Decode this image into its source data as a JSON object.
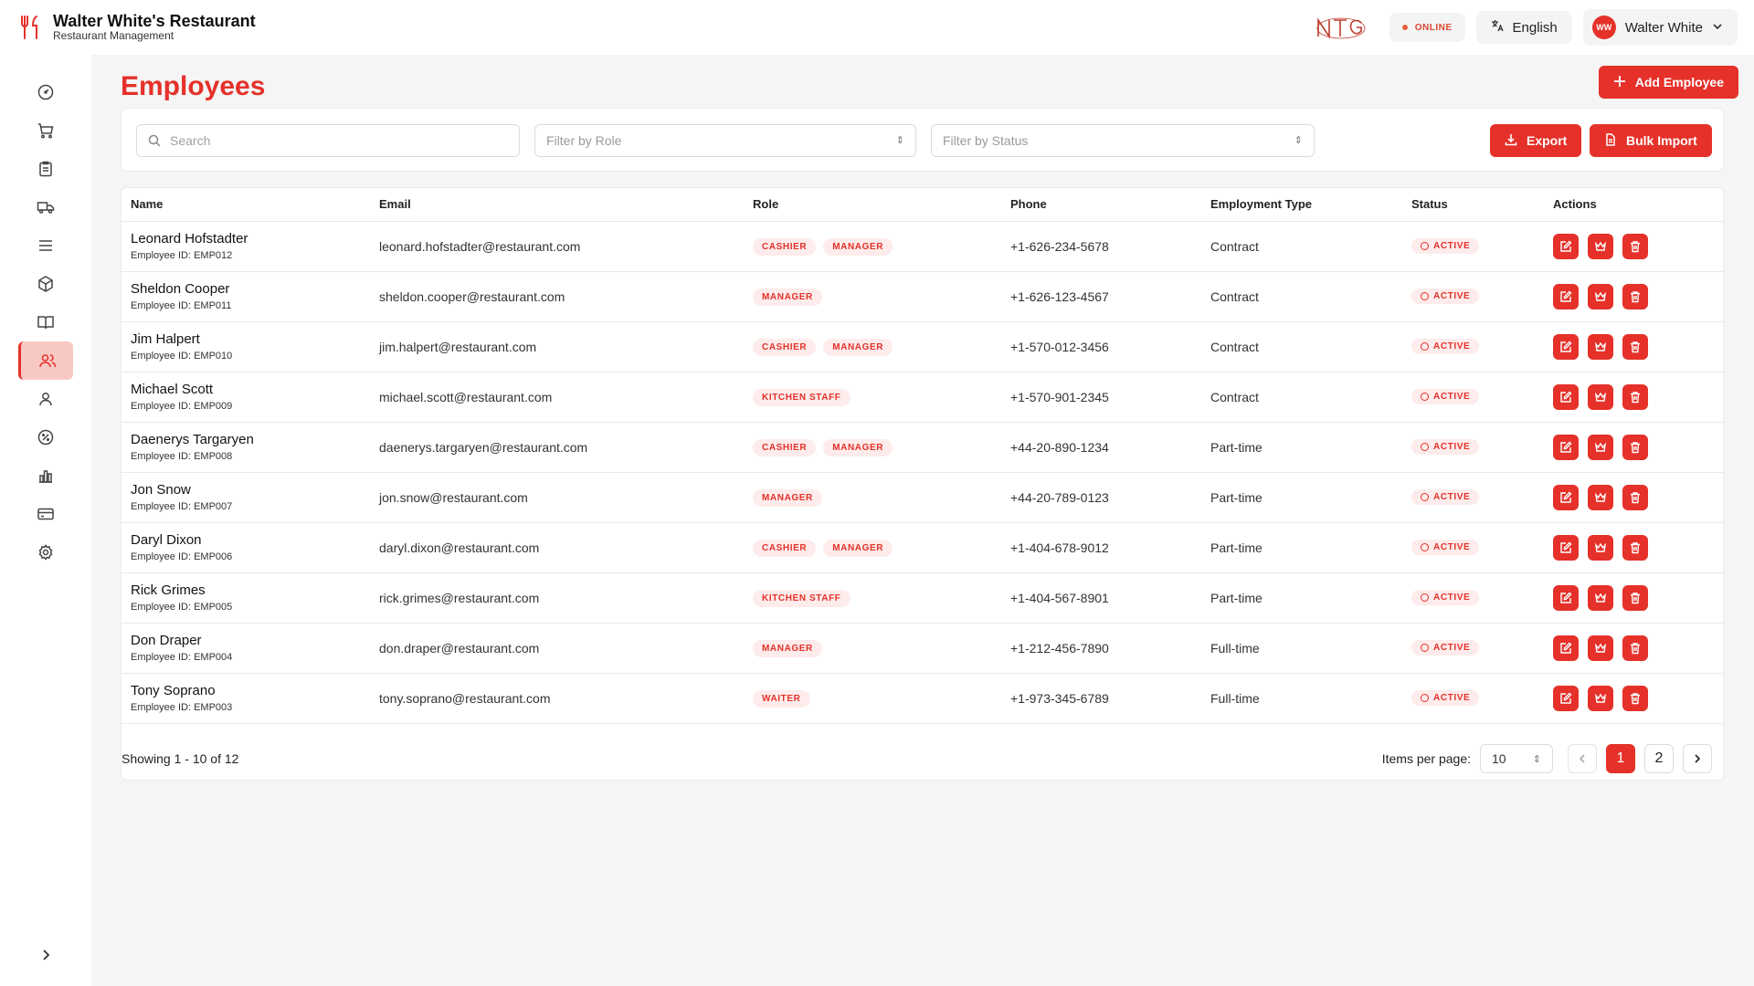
{
  "app": {
    "title": "Walter White's Restaurant",
    "subtitle": "Restaurant Management"
  },
  "header": {
    "status": "ONLINE",
    "language": "English",
    "user": {
      "initials": "WW",
      "name": "Walter White"
    }
  },
  "colors": {
    "accent": "#e5312a",
    "accent_soft": "#fdeceb",
    "active_nav": "#f8c9c4"
  },
  "sidebar": {
    "items": [
      {
        "icon": "dashboard-icon"
      },
      {
        "icon": "cart-icon"
      },
      {
        "icon": "clipboard-icon"
      },
      {
        "icon": "truck-icon"
      },
      {
        "icon": "menu-list-icon"
      },
      {
        "icon": "package-icon"
      },
      {
        "icon": "book-icon"
      },
      {
        "icon": "users-icon",
        "active": true
      },
      {
        "icon": "user-icon"
      },
      {
        "icon": "percent-icon"
      },
      {
        "icon": "bar-chart-icon"
      },
      {
        "icon": "credit-card-icon"
      },
      {
        "icon": "settings-icon"
      }
    ]
  },
  "page": {
    "title": "Employees",
    "add_button": "Add Employee"
  },
  "filters": {
    "search_placeholder": "Search",
    "role_placeholder": "Filter by Role",
    "status_placeholder": "Filter by Status",
    "export_label": "Export",
    "bulk_import_label": "Bulk Import"
  },
  "table": {
    "columns": [
      "Name",
      "Email",
      "Role",
      "Phone",
      "Employment Type",
      "Status",
      "Actions"
    ],
    "id_prefix": "Employee ID: ",
    "rows": [
      {
        "name": "Leonard Hofstadter",
        "id": "EMP012",
        "email": "leonard.hofstadter@restaurant.com",
        "roles": [
          "CASHIER",
          "MANAGER"
        ],
        "phone": "+1-626-234-5678",
        "type": "Contract",
        "status": "ACTIVE"
      },
      {
        "name": "Sheldon Cooper",
        "id": "EMP011",
        "email": "sheldon.cooper@restaurant.com",
        "roles": [
          "MANAGER"
        ],
        "phone": "+1-626-123-4567",
        "type": "Contract",
        "status": "ACTIVE"
      },
      {
        "name": "Jim Halpert",
        "id": "EMP010",
        "email": "jim.halpert@restaurant.com",
        "roles": [
          "CASHIER",
          "MANAGER"
        ],
        "phone": "+1-570-012-3456",
        "type": "Contract",
        "status": "ACTIVE"
      },
      {
        "name": "Michael Scott",
        "id": "EMP009",
        "email": "michael.scott@restaurant.com",
        "roles": [
          "KITCHEN STAFF"
        ],
        "phone": "+1-570-901-2345",
        "type": "Contract",
        "status": "ACTIVE"
      },
      {
        "name": "Daenerys Targaryen",
        "id": "EMP008",
        "email": "daenerys.targaryen@restaurant.com",
        "roles": [
          "CASHIER",
          "MANAGER"
        ],
        "phone": "+44-20-890-1234",
        "type": "Part-time",
        "status": "ACTIVE"
      },
      {
        "name": "Jon Snow",
        "id": "EMP007",
        "email": "jon.snow@restaurant.com",
        "roles": [
          "MANAGER"
        ],
        "phone": "+44-20-789-0123",
        "type": "Part-time",
        "status": "ACTIVE"
      },
      {
        "name": "Daryl Dixon",
        "id": "EMP006",
        "email": "daryl.dixon@restaurant.com",
        "roles": [
          "CASHIER",
          "MANAGER"
        ],
        "phone": "+1-404-678-9012",
        "type": "Part-time",
        "status": "ACTIVE"
      },
      {
        "name": "Rick Grimes",
        "id": "EMP005",
        "email": "rick.grimes@restaurant.com",
        "roles": [
          "KITCHEN STAFF"
        ],
        "phone": "+1-404-567-8901",
        "type": "Part-time",
        "status": "ACTIVE"
      },
      {
        "name": "Don Draper",
        "id": "EMP004",
        "email": "don.draper@restaurant.com",
        "roles": [
          "MANAGER"
        ],
        "phone": "+1-212-456-7890",
        "type": "Full-time",
        "status": "ACTIVE"
      },
      {
        "name": "Tony Soprano",
        "id": "EMP003",
        "email": "tony.soprano@restaurant.com",
        "roles": [
          "WAITER"
        ],
        "phone": "+1-973-345-6789",
        "type": "Full-time",
        "status": "ACTIVE"
      }
    ]
  },
  "pagination": {
    "showing": "Showing 1 - 10 of 12",
    "items_per_page_label": "Items per page:",
    "items_per_page": "10",
    "pages": [
      "1",
      "2"
    ],
    "current_page": "1"
  }
}
